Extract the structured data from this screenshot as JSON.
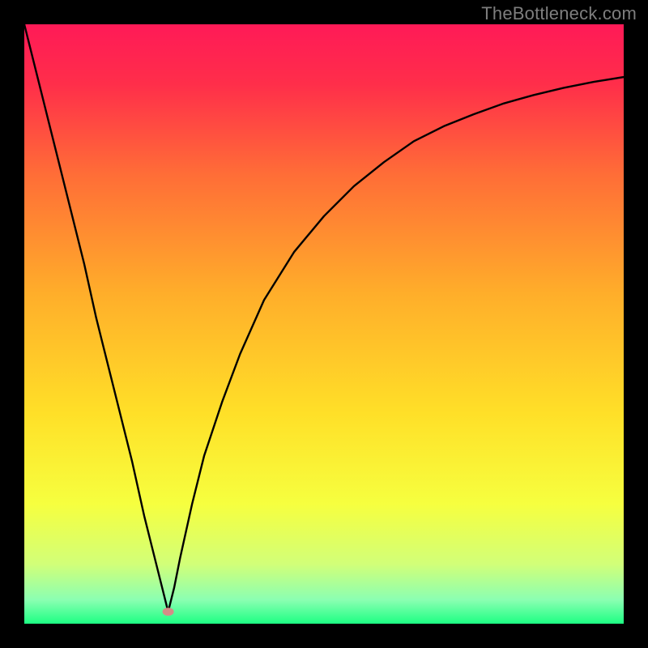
{
  "watermark": "TheBottleneck.com",
  "chart_data": {
    "type": "line",
    "title": "",
    "xlabel": "",
    "ylabel": "",
    "xlim": [
      0,
      100
    ],
    "ylim": [
      0,
      100
    ],
    "grid": false,
    "legend": false,
    "background": {
      "type": "vertical-gradient",
      "stops": [
        {
          "pos": 0.0,
          "color": "#ff1a57"
        },
        {
          "pos": 0.1,
          "color": "#ff2e4a"
        },
        {
          "pos": 0.25,
          "color": "#ff6d37"
        },
        {
          "pos": 0.45,
          "color": "#ffae2a"
        },
        {
          "pos": 0.65,
          "color": "#ffe028"
        },
        {
          "pos": 0.8,
          "color": "#f6ff3f"
        },
        {
          "pos": 0.9,
          "color": "#d2ff78"
        },
        {
          "pos": 0.96,
          "color": "#8bffb2"
        },
        {
          "pos": 1.0,
          "color": "#1dff83"
        }
      ]
    },
    "vertex_marker": {
      "x": 24,
      "y": 2,
      "color": "#d58c87"
    },
    "series": [
      {
        "name": "curve",
        "color": "#000000",
        "type": "line",
        "x": [
          0,
          2,
          4,
          6,
          8,
          10,
          12,
          14,
          16,
          18,
          20,
          22,
          23,
          24,
          25,
          26,
          28,
          30,
          33,
          36,
          40,
          45,
          50,
          55,
          60,
          65,
          70,
          75,
          80,
          85,
          90,
          95,
          100
        ],
        "values": [
          100,
          92,
          84,
          76,
          68,
          60,
          51,
          43,
          35,
          27,
          18,
          10,
          6,
          2,
          6,
          11,
          20,
          28,
          37,
          45,
          54,
          62,
          68,
          73,
          77,
          80.5,
          83,
          85,
          86.8,
          88.2,
          89.4,
          90.4,
          91.2
        ]
      }
    ]
  }
}
